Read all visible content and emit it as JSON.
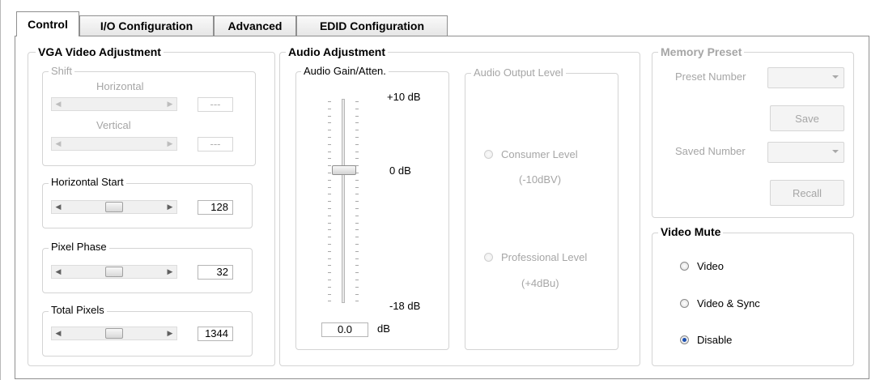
{
  "tabs": [
    "Control",
    "I/O Configuration",
    "Advanced",
    "EDID Configuration"
  ],
  "vga": {
    "title": "VGA Video Adjustment",
    "shift": {
      "label": "Shift",
      "horizontal_label": "Horizontal",
      "horizontal_value": "---",
      "vertical_label": "Vertical",
      "vertical_value": "---"
    },
    "horizontal_start": {
      "label": "Horizontal Start",
      "value": "128",
      "position": 0.5
    },
    "pixel_phase": {
      "label": "Pixel Phase",
      "value": "32",
      "position": 0.5
    },
    "total_pixels": {
      "label": "Total Pixels",
      "value": "1344",
      "position": 0.5
    }
  },
  "audio": {
    "title": "Audio Adjustment",
    "gain": {
      "label": "Audio Gain/Atten.",
      "max_label": "+10 dB",
      "mid_label": "0 dB",
      "min_label": "-18 dB",
      "value": "0.0",
      "unit": "dB"
    },
    "output_level": {
      "label": "Audio Output Level",
      "consumer_label": "Consumer Level",
      "consumer_sub": "(-10dBV)",
      "professional_label": "Professional Level",
      "professional_sub": "(+4dBu)"
    }
  },
  "memory": {
    "title": "Memory Preset",
    "preset_number_label": "Preset Number",
    "save_label": "Save",
    "saved_number_label": "Saved Number",
    "recall_label": "Recall"
  },
  "video_mute": {
    "title": "Video Mute",
    "options": [
      "Video",
      "Video & Sync",
      "Disable"
    ],
    "selected": "Disable"
  },
  "colors": {
    "radio_selected": "#1b4fb0",
    "disabled_text": "#a6a6a6"
  }
}
